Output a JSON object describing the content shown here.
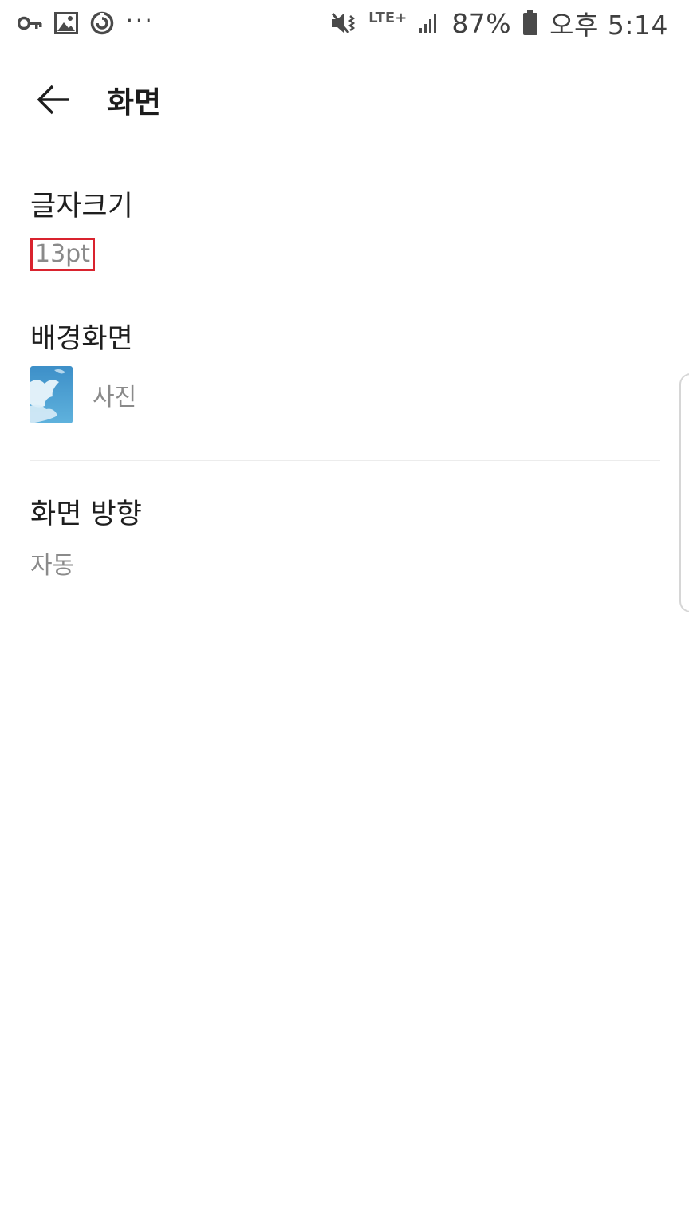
{
  "status_bar": {
    "left_icons": [
      "key-icon",
      "image-icon",
      "sync-icon",
      "more-dots-icon"
    ],
    "network_label": "LTE+",
    "battery_percent": "87%",
    "time": "오후 5:14"
  },
  "toolbar": {
    "back_icon": "arrow-left-icon",
    "title": "화면"
  },
  "settings": {
    "font_size": {
      "title": "글자크기",
      "value": "13pt",
      "highlight_color": "#d9232e"
    },
    "background": {
      "title": "배경화면",
      "value": "사진"
    },
    "orientation": {
      "title": "화면 방향",
      "value": "자동"
    }
  },
  "colors": {
    "primary_text": "#1e1e1e",
    "secondary_text": "#8a8a8a",
    "divider": "#ececec"
  }
}
